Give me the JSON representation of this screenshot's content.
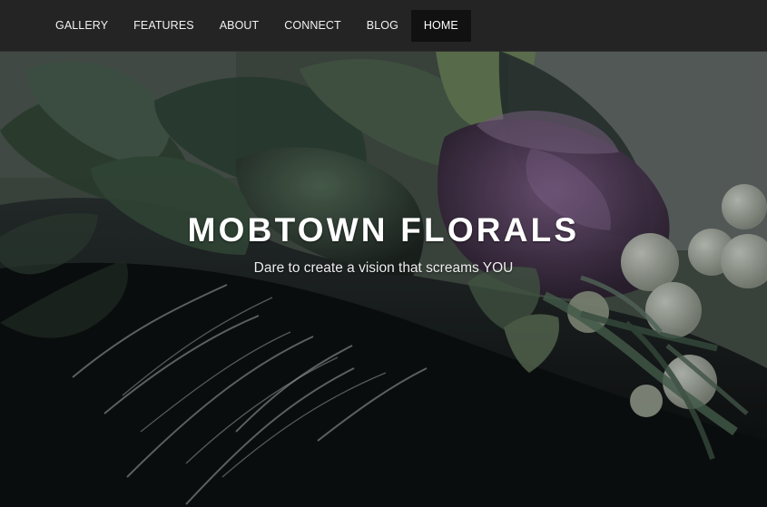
{
  "nav": {
    "items": [
      {
        "label": "GALLERY"
      },
      {
        "label": "FEATURES"
      },
      {
        "label": "ABOUT"
      },
      {
        "label": "CONNECT"
      },
      {
        "label": "BLOG"
      },
      {
        "label": "HOME",
        "active": true
      }
    ]
  },
  "hero": {
    "title": "MOBTOWN FLORALS",
    "subtitle": "Dare to create a vision that screams YOU"
  },
  "colors": {
    "navbar_bg": "#242424",
    "active_nav_bg": "#111111",
    "nav_text": "#f2f2f2",
    "hero_text": "#ffffff"
  }
}
